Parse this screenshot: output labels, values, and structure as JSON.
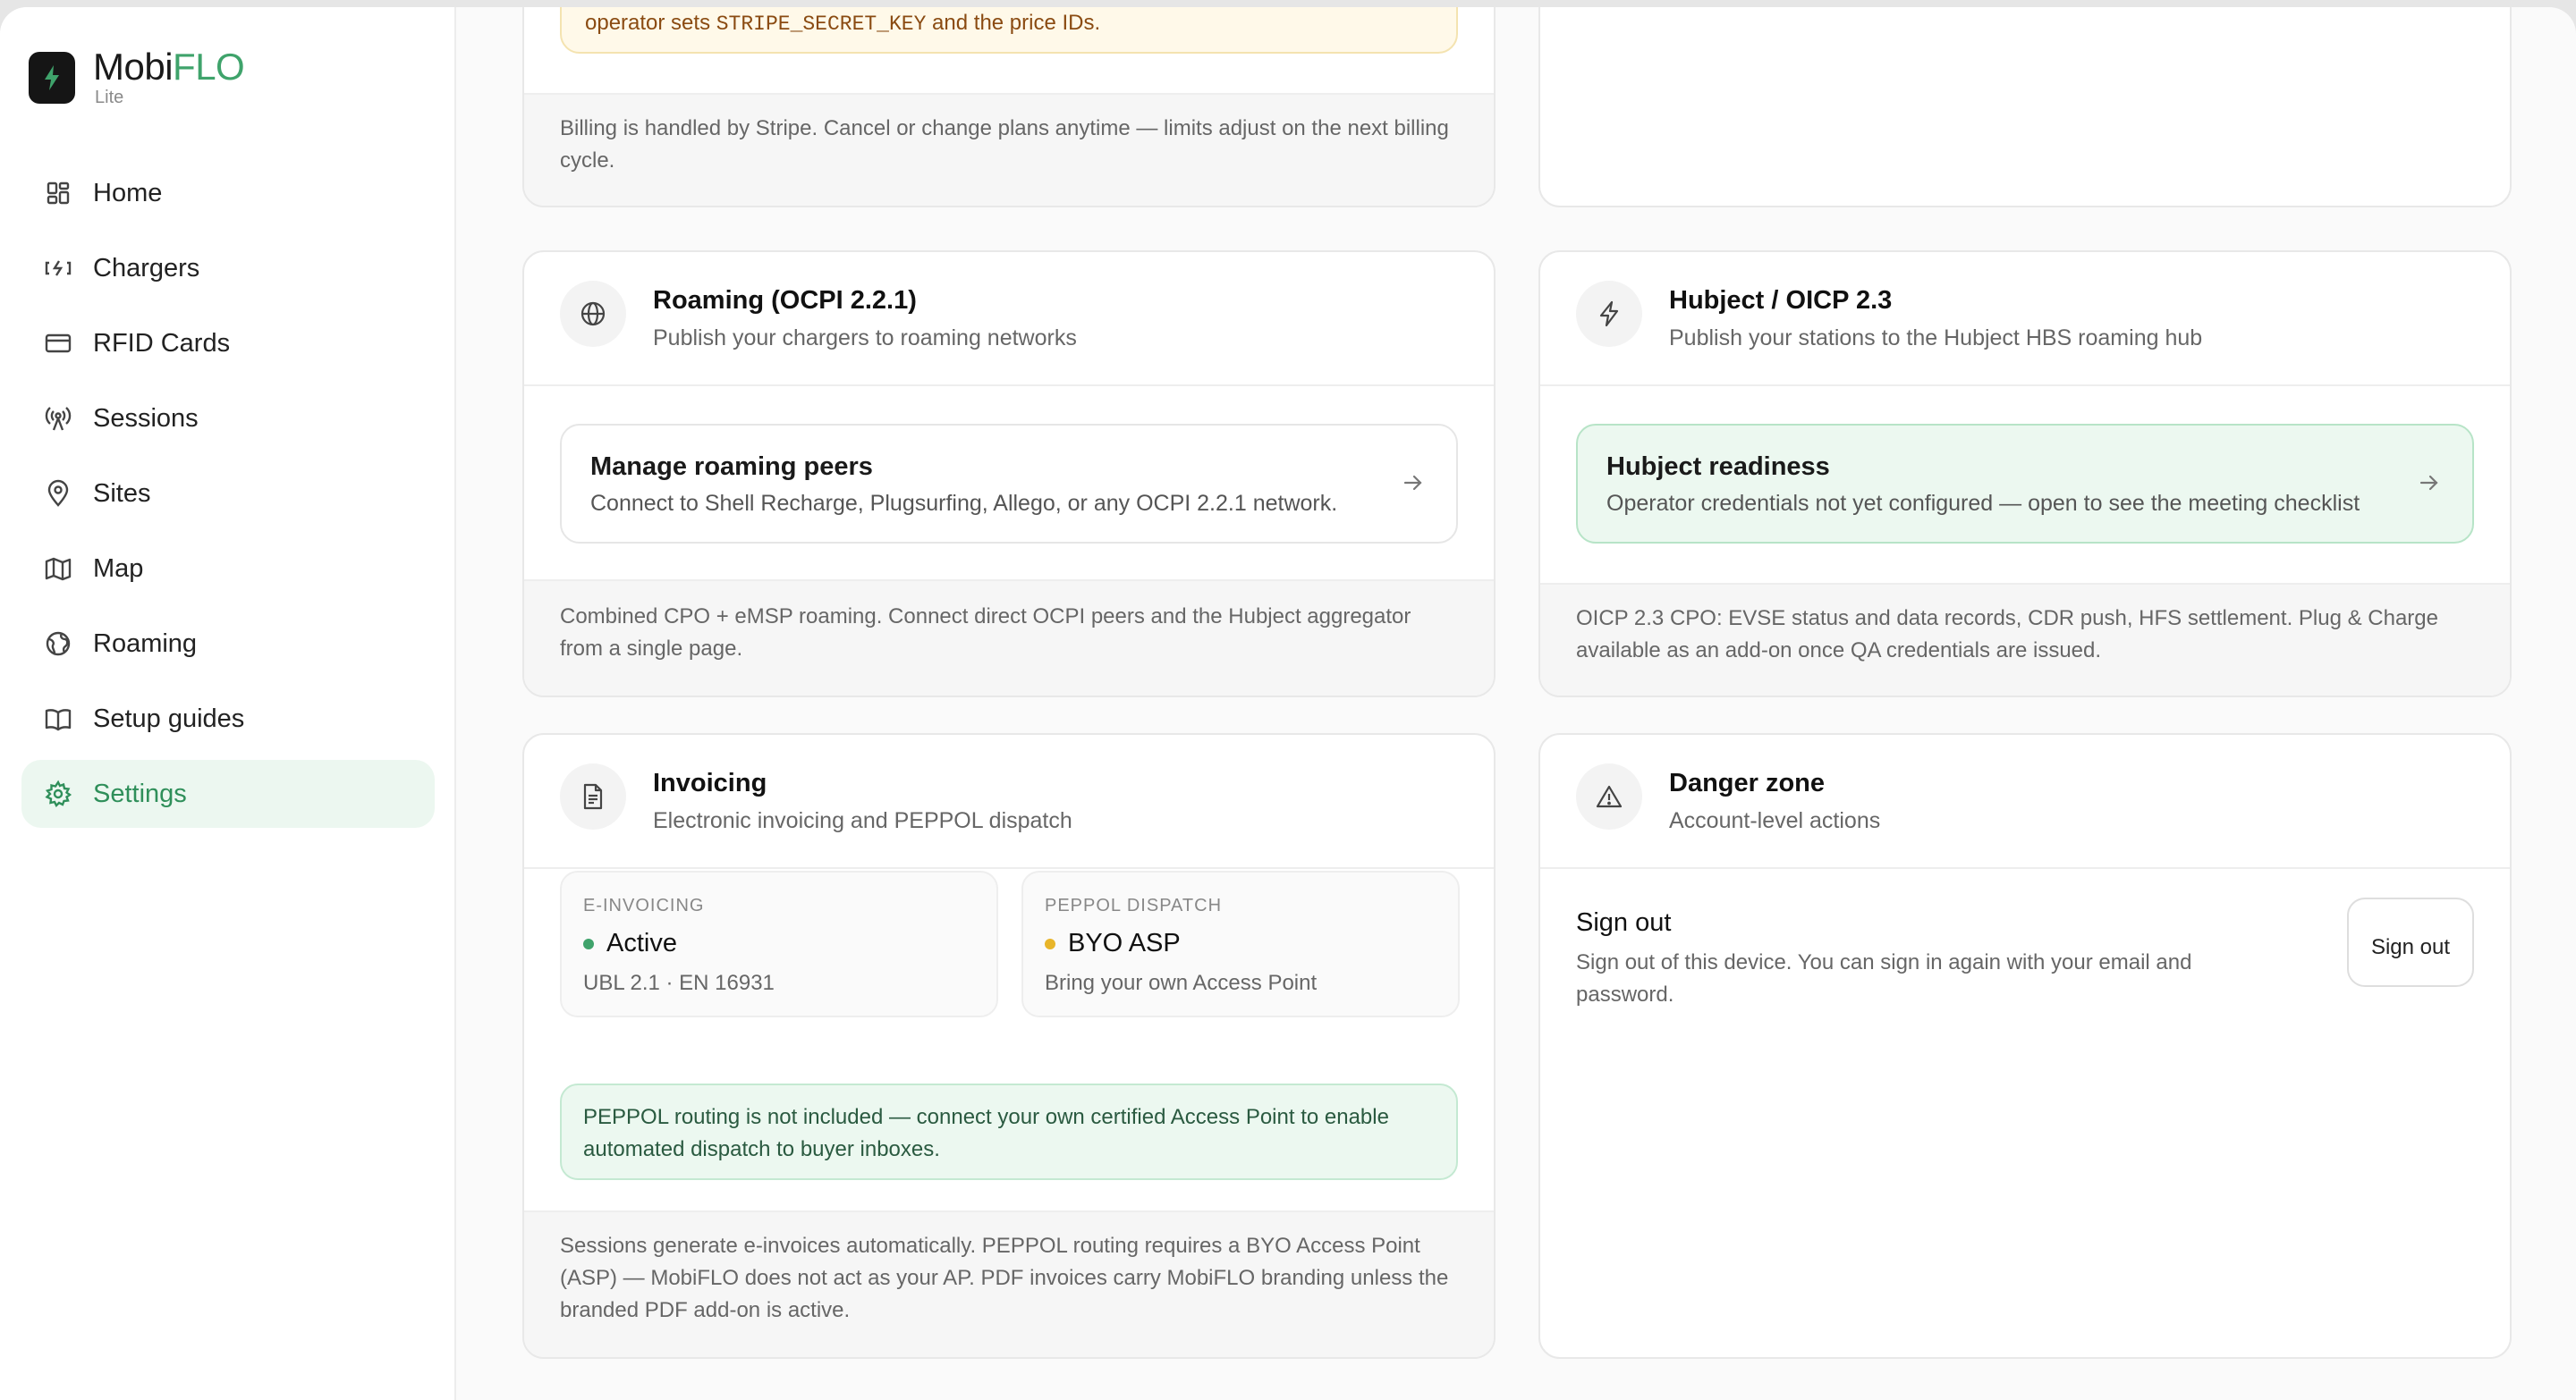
{
  "brand": {
    "name_main": "Mobi",
    "name_accent": "FLO",
    "tier": "Lite"
  },
  "nav": [
    {
      "label": "Home",
      "icon": "dashboard-icon"
    },
    {
      "label": "Chargers",
      "icon": "charger-icon"
    },
    {
      "label": "RFID Cards",
      "icon": "card-icon"
    },
    {
      "label": "Sessions",
      "icon": "broadcast-icon"
    },
    {
      "label": "Sites",
      "icon": "pin-icon"
    },
    {
      "label": "Map",
      "icon": "map-icon"
    },
    {
      "label": "Roaming",
      "icon": "globe-icon"
    },
    {
      "label": "Setup guides",
      "icon": "book-icon"
    },
    {
      "label": "Settings",
      "icon": "gear-icon",
      "active": true
    }
  ],
  "billing": {
    "note_prefix": "operator sets ",
    "note_code": "STRIPE_SECRET_KEY",
    "note_suffix": " and the price IDs.",
    "footer": "Billing is handled by Stripe. Cancel or change plans anytime — limits adjust on the next billing cycle."
  },
  "roaming": {
    "title": "Roaming (OCPI 2.2.1)",
    "subtitle": "Publish your chargers to roaming networks",
    "link_title": "Manage roaming peers",
    "link_sub": "Connect to Shell Recharge, Plugsurfing, Allego, or any OCPI 2.2.1 network.",
    "footer": "Combined CPO + eMSP roaming. Connect direct OCPI peers and the Hubject aggregator from a single page."
  },
  "hubject": {
    "title": "Hubject / OICP 2.3",
    "subtitle": "Publish your stations to the Hubject HBS roaming hub",
    "link_title": "Hubject readiness",
    "link_sub": "Operator credentials not yet configured — open to see the meeting checklist",
    "footer": "OICP 2.3 CPO: EVSE status and data records, CDR push, HFS settlement. Plug & Charge available as an add-on once QA credentials are issued."
  },
  "invoicing": {
    "title": "Invoicing",
    "subtitle": "Electronic invoicing and PEPPOL dispatch",
    "einvoicing_label": "E-INVOICING",
    "einvoicing_value": "Active",
    "einvoicing_sub": "UBL 2.1 · EN 16931",
    "peppol_label": "PEPPOL DISPATCH",
    "peppol_value": "BYO ASP",
    "peppol_sub": "Bring your own Access Point",
    "notice": "PEPPOL routing is not included — connect your own certified Access Point to enable automated dispatch to buyer inboxes.",
    "footer": "Sessions generate e-invoices automatically. PEPPOL routing requires a BYO Access Point (ASP) — MobiFLO does not act as your AP. PDF invoices carry MobiFLO branding unless the branded PDF add-on is active."
  },
  "danger": {
    "title": "Danger zone",
    "subtitle": "Account-level actions",
    "signout_title": "Sign out",
    "signout_desc": "Sign out of this device. You can sign in again with your email and password.",
    "signout_button": "Sign out"
  },
  "colors": {
    "accent": "#3fa36b",
    "active_bg": "#ecf7f0",
    "warning_dot": "#e8b52a",
    "ok_dot": "#3fa36b"
  }
}
